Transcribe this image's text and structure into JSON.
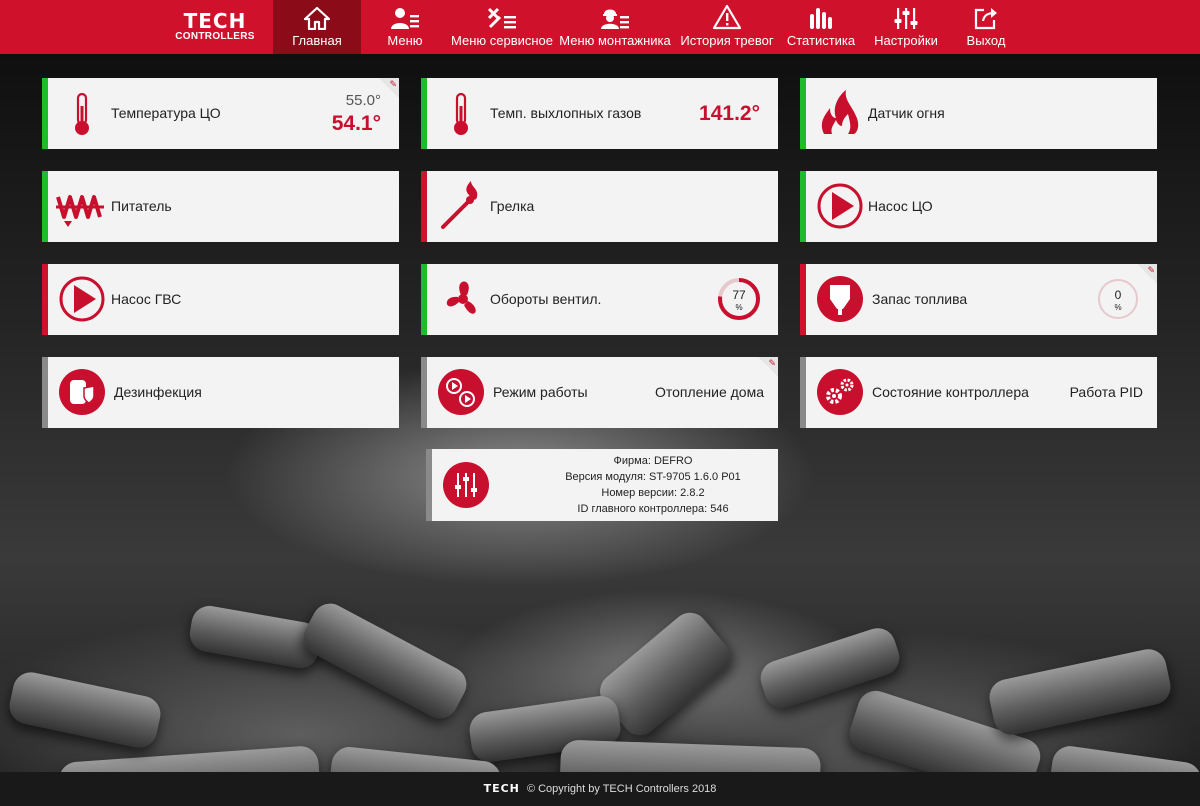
{
  "logo": {
    "main": "TECH",
    "sub": "CONTROLLERS"
  },
  "nav": [
    {
      "label": "Главная",
      "icon": "home-icon"
    },
    {
      "label": "Меню",
      "icon": "user-menu-icon"
    },
    {
      "label": "Меню сервисное",
      "icon": "tools-icon"
    },
    {
      "label": "Меню монтажника",
      "icon": "installer-icon"
    },
    {
      "label": "История тревог",
      "icon": "warning-icon"
    },
    {
      "label": "Статистика",
      "icon": "stats-icon"
    },
    {
      "label": "Настройки",
      "icon": "sliders-icon"
    },
    {
      "label": "Выход",
      "icon": "exit-icon"
    }
  ],
  "tiles": {
    "temp_co": {
      "label": "Температура ЦО",
      "set": "55.0°",
      "current": "54.1°"
    },
    "exhaust": {
      "label": "Темп. выхлопных газов",
      "value": "141.2°"
    },
    "fire_sensor": {
      "label": "Датчик огня"
    },
    "feeder": {
      "label": "Питатель"
    },
    "heater": {
      "label": "Грелка"
    },
    "pump_co": {
      "label": "Насос ЦО"
    },
    "pump_dhw": {
      "label": "Насос ГВС"
    },
    "fan_speed": {
      "label": "Обороты вентил.",
      "value": "77",
      "unit": "%",
      "level": 0.77
    },
    "fuel": {
      "label": "Запас топлива",
      "value": "0",
      "unit": "%",
      "level": 0
    },
    "disinfection": {
      "label": "Дезинфекция"
    },
    "work_mode": {
      "label": "Режим работы",
      "value": "Отопление дома"
    },
    "controller_state": {
      "label": "Состояние контроллера",
      "value": "Работа PID"
    }
  },
  "info": {
    "company": "Фирма: DEFRO",
    "module_version": "Версия модуля: ST-9705 1.6.0 P01",
    "version_number": "Номер версии: 2.8.2",
    "main_id": "ID главного контроллера: 546"
  },
  "footer": {
    "logo": "TECH",
    "text": "© Copyright by TECH Controllers 2018"
  },
  "colors": {
    "brand": "#d0112b",
    "active_nav": "#8c0b19",
    "on": "#1cbc2a",
    "off": "#d0112b"
  }
}
